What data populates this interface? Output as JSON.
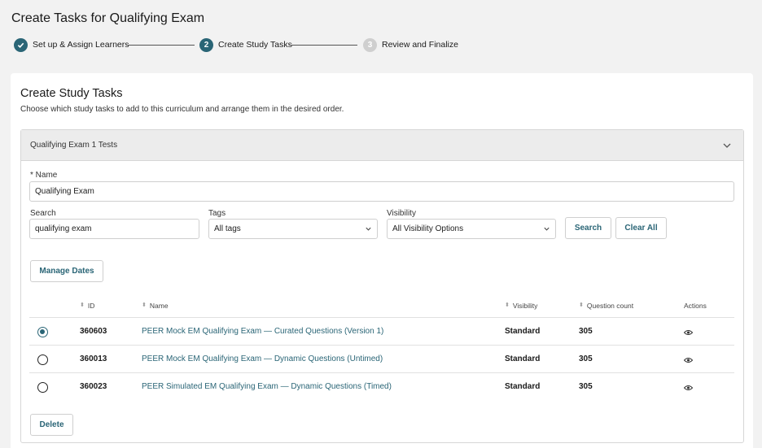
{
  "page": {
    "title": "Create Tasks for Qualifying Exam"
  },
  "stepper": {
    "steps": [
      {
        "number": "1",
        "label": "Set up & Assign Learners",
        "status": "done"
      },
      {
        "number": "2",
        "label": "Create Study Tasks",
        "status": "current"
      },
      {
        "number": "3",
        "label": "Review and Finalize",
        "status": "todo"
      }
    ]
  },
  "card": {
    "title": "Create Study Tasks",
    "description": "Choose which study tasks to add to this curriculum and arrange them in the desired order."
  },
  "panel": {
    "title": "Qualifying Exam 1 Tests",
    "name_label": "* Name",
    "name_value": "Qualifying Exam",
    "search_label": "Search",
    "search_value": "qualifying exam",
    "tags_label": "Tags",
    "tags_value": "All tags",
    "visibility_label": "Visibility",
    "visibility_value": "All Visibility Options",
    "search_button": "Search",
    "clear_button": "Clear All",
    "manage_dates_button": "Manage Dates",
    "delete_button": "Delete"
  },
  "table": {
    "headers": {
      "id": "ID",
      "name": "Name",
      "visibility": "Visibility",
      "question_count": "Question count",
      "actions": "Actions"
    },
    "rows": [
      {
        "selected": true,
        "id": "360603",
        "name": "PEER Mock EM Qualifying Exam — Curated Questions (Version 1)",
        "visibility": "Standard",
        "question_count": "305"
      },
      {
        "selected": false,
        "id": "360013",
        "name": "PEER Mock EM Qualifying Exam — Dynamic Questions (Untimed)",
        "visibility": "Standard",
        "question_count": "305"
      },
      {
        "selected": false,
        "id": "360023",
        "name": "PEER Simulated EM Qualifying Exam — Dynamic Questions (Timed)",
        "visibility": "Standard",
        "question_count": "305"
      }
    ]
  },
  "colors": {
    "accent": "#2a6576",
    "inactive_step": "#cfcfcf",
    "panel_header": "#ececec"
  },
  "icons": {
    "step_done": "check-icon",
    "accordion": "chevron-down-icon",
    "select": "chevron-down-icon",
    "view": "eye-icon"
  }
}
